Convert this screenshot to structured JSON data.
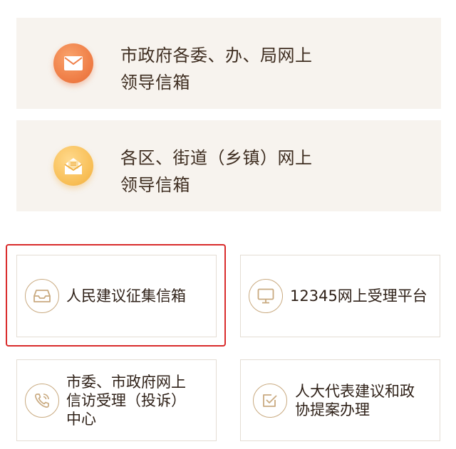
{
  "cards": {
    "city_mailbox": {
      "line1": "市政府各委、办、局网上",
      "line2": "领导信箱",
      "icon": "mail-icon"
    },
    "district_mailbox": {
      "line1": "各区、街道（乡镇）网上",
      "line2": "领导信箱",
      "icon": "open-letter-icon"
    }
  },
  "tiles": {
    "suggestion": {
      "label": "人民建议征集信箱",
      "icon": "inbox-icon"
    },
    "hotline": {
      "label": "12345网上受理平台",
      "icon": "monitor-icon"
    },
    "petition": {
      "line1": "市委、市政府网上",
      "line2": "信访受理（投诉）",
      "line3": "中心",
      "icon": "phone-icon"
    },
    "npc": {
      "line1": "人大代表建议和政",
      "line2": "协提案办理",
      "icon": "checkbox-icon"
    }
  },
  "colors": {
    "accent_orange": "#ef7d46",
    "accent_yellow": "#f8bf57",
    "gold_outline": "#c9aa80",
    "highlight_red": "#d92b2b",
    "card_bg": "#f7f3ee"
  }
}
